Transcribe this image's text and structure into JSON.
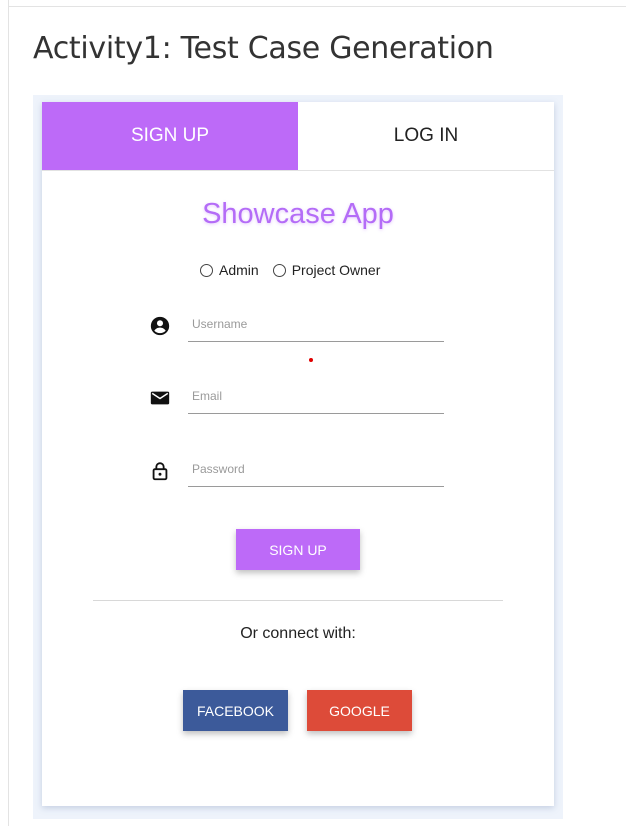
{
  "page": {
    "title": "Activity1: Test Case Generation"
  },
  "app": {
    "tabs": [
      {
        "label": "SIGN UP",
        "active": true
      },
      {
        "label": "LOG IN",
        "active": false
      }
    ],
    "title": "Showcase App",
    "roles": [
      {
        "label": "Admin",
        "selected": false
      },
      {
        "label": "Project Owner",
        "selected": false
      }
    ],
    "fields": {
      "username": {
        "placeholder": "Username",
        "value": "",
        "icon": "account-circle-icon"
      },
      "email": {
        "placeholder": "Email",
        "value": "",
        "icon": "mail-icon"
      },
      "password": {
        "placeholder": "Password",
        "value": "",
        "icon": "lock-icon"
      }
    },
    "signup_button": "SIGN UP",
    "connect_text": "Or connect with:",
    "social": {
      "facebook": "FACEBOOK",
      "google": "GOOGLE"
    },
    "colors": {
      "accent": "#bd6af8",
      "facebook": "#3c5a9a",
      "google": "#dd4b39"
    }
  }
}
